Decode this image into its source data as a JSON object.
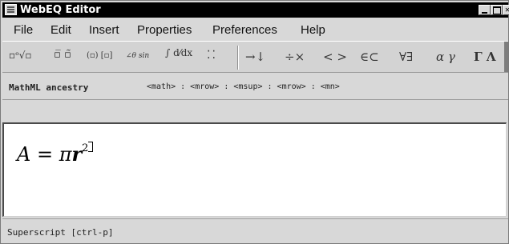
{
  "window": {
    "title": "WebEQ Editor",
    "icon": "app-icon"
  },
  "menu": {
    "items": [
      "File",
      "Edit",
      "Insert",
      "Properties",
      "Preferences",
      "Help"
    ]
  },
  "toolbar": {
    "tools": [
      "▫ᵒ√▫",
      "▫̅ ▫̃",
      "(▫) [▫]",
      "∠θ sin",
      "∫ d⁄dx",
      "⁚⁚",
      "→↓",
      "÷×",
      "< >",
      "∈⊂",
      "∀∃",
      "α γ",
      "Γ Λ"
    ]
  },
  "ancestry": {
    "label": "MathML ancestry",
    "path": "<math> : <mrow> : <msup> : <mrow> : <mn>"
  },
  "editor": {
    "equation": {
      "lhs": "A",
      "equals": " = ",
      "pi": "π",
      "r": "r",
      "exponent": "2"
    }
  },
  "status": {
    "text": "Superscript [ctrl-p]"
  },
  "colors": {
    "titlebar": "#000000",
    "chrome": "#d8d8d8",
    "editor_bg": "#ffffff"
  }
}
